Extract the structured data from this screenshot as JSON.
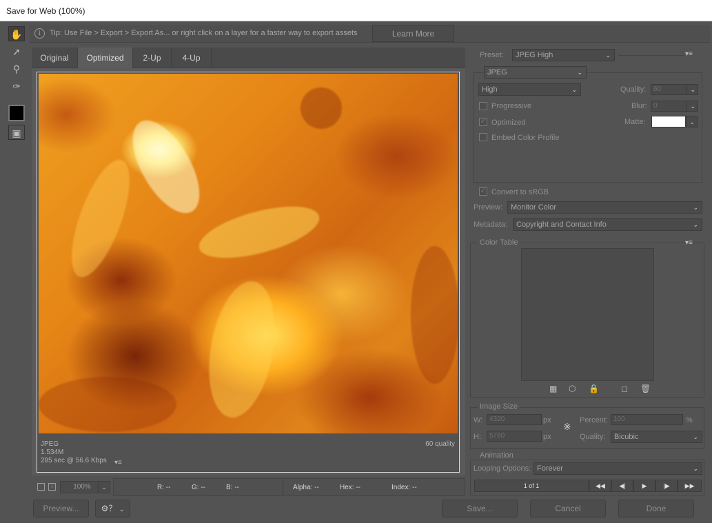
{
  "window": {
    "title": "Save for Web (100%)"
  },
  "tipbar": {
    "info_icon": "info-circle-icon",
    "tip_text": "Tip: Use File > Export > Export As...  or right click on a layer for a faster way to export assets",
    "learn_more_label": "Learn More"
  },
  "tools": [
    "hand-tool-icon",
    "slice-select-tool-icon",
    "zoom-tool-icon",
    "eyedropper-tool-icon",
    "eyedropper-color-swatch",
    "toggle-slices-icon"
  ],
  "view_tabs": [
    "Original",
    "Optimized",
    "2-Up",
    "4-Up"
  ],
  "active_tab": "Optimized",
  "image_info": {
    "format": "JPEG",
    "size": "1.534M",
    "time": "285 sec @ 56.6 Kbps",
    "quality": "60 quality",
    "menu_icon": "▾≡"
  },
  "bottom": {
    "zoom": "100%",
    "r": "R: --",
    "g": "G: --",
    "b": "B: --",
    "alpha": "Alpha: --",
    "hex": "Hex: --",
    "index": "Index: --"
  },
  "footer": {
    "preview_label": "Preview...",
    "save_label": "Save...",
    "cancel_label": "Cancel",
    "done_label": "Done"
  },
  "settings": {
    "preset_label": "Preset:",
    "preset_value": "JPEG High",
    "format_value": "JPEG",
    "compression_value": "High",
    "quality_label": "Quality:",
    "quality_value": "60",
    "progressive_label": "Progressive",
    "blur_label": "Blur:",
    "blur_value": "0",
    "optimized_label": "Optimized",
    "matte_label": "Matte:",
    "embed_profile_label": "Embed Color Profile",
    "convert_srgb_label": "Convert to sRGB",
    "preview_label": "Preview:",
    "preview_value": "Monitor Color",
    "metadata_label": "Metadata:",
    "metadata_value": "Copyright and Contact Info",
    "menu_icon": "▾≡"
  },
  "color_table": {
    "title": "Color Table",
    "menu_icon": "▾≡"
  },
  "image_size": {
    "title": "Image Size",
    "w_label": "W:",
    "w_value": "4320",
    "h_label": "H:",
    "h_value": "5760",
    "unit": "px",
    "percent_label": "Percent:",
    "percent_value": "100",
    "percent_unit": "%",
    "quality_label": "Quality:",
    "quality_value": "Bicubic"
  },
  "animation": {
    "title": "Animation",
    "looping_label": "Looping Options:",
    "looping_value": "Forever",
    "frame_counter": "1 of 1"
  },
  "colors": {
    "dialog_bg": "#535353",
    "accent_image": "#e58516"
  }
}
